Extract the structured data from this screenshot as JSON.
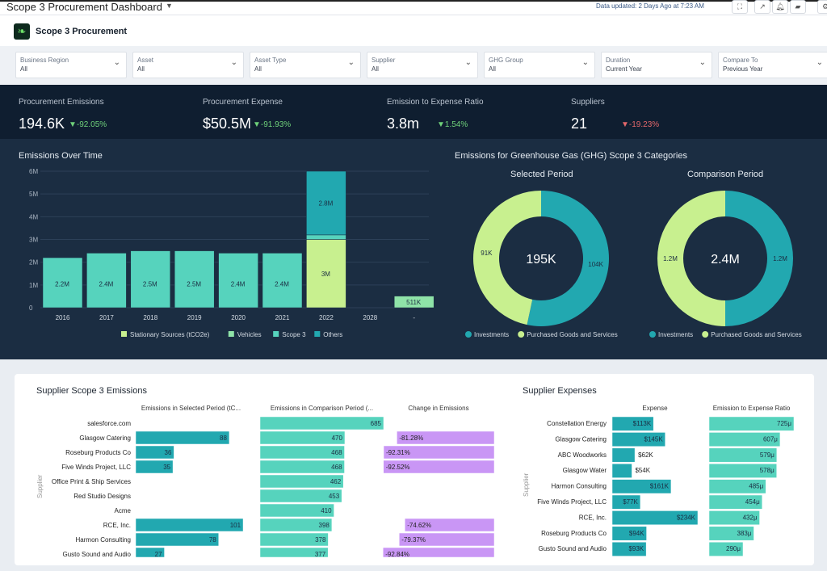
{
  "topbar": {
    "title": "Scope 3 Procurement Dashboard",
    "updated": "Data updated: 2 Days Ago at 7:23 AM",
    "icons": [
      "fullscreen-icon",
      "share-icon",
      "bell-icon",
      "folder-icon",
      "settings-icon"
    ]
  },
  "header": {
    "brand": "Scope 3 Procurement",
    "logo_icon": "leaf-icon"
  },
  "filters": [
    {
      "label": "Business Region",
      "value": "All"
    },
    {
      "label": "Asset",
      "value": "All"
    },
    {
      "label": "Asset Type",
      "value": "All"
    },
    {
      "label": "Supplier",
      "value": "All"
    },
    {
      "label": "GHG Group",
      "value": "All"
    },
    {
      "label": "Duration",
      "value": "Current Year"
    },
    {
      "label": "Compare To",
      "value": "Previous Year"
    }
  ],
  "kpis": [
    {
      "label": "Procurement Emissions",
      "value": "194.6K",
      "delta": "▼-92.05%",
      "color": "#6fd17a"
    },
    {
      "label": "Procurement Expense",
      "value": "$50.5M",
      "delta": "▼-91.93%",
      "color": "#6fd17a"
    },
    {
      "label": "Emission to Expense Ratio",
      "value": "3.8m",
      "delta": "▼1.54%",
      "color": "#6fd17a"
    },
    {
      "label": "Suppliers",
      "value": "21",
      "delta": "▼-19.23%",
      "color": "#e2676a"
    }
  ],
  "colors": {
    "stationary": "#c8f08f",
    "vehicles": "#8fe3a8",
    "scope3": "#56d3bd",
    "others": "#22a8b0",
    "purple": "#c996f5",
    "navy": "#1b2d42"
  },
  "chart_data": [
    {
      "type": "bar",
      "title": "Emissions Over Time",
      "stacked": true,
      "categories": [
        "2016",
        "2017",
        "2018",
        "2019",
        "2020",
        "2021",
        "2022",
        "2028",
        "-"
      ],
      "yticks": [
        "0",
        "1M",
        "2M",
        "3M",
        "4M",
        "5M",
        "6M"
      ],
      "ylim": [
        0,
        6000000
      ],
      "grid": true,
      "legend": "bottom",
      "series": [
        {
          "name": "Stationary Sources (tCO2e)",
          "values": [
            0,
            0,
            0,
            0,
            0,
            0,
            3000000,
            0,
            0
          ]
        },
        {
          "name": "Vehicles",
          "values": [
            0,
            0,
            0,
            0,
            0,
            0,
            0,
            0,
            511000
          ]
        },
        {
          "name": "Scope 3",
          "values": [
            2200000,
            2400000,
            2500000,
            2500000,
            2400000,
            2400000,
            200000,
            0,
            0
          ]
        },
        {
          "name": "Others",
          "values": [
            0,
            0,
            0,
            0,
            0,
            0,
            2800000,
            0,
            0
          ]
        }
      ],
      "labels": [
        [
          "2.2M"
        ],
        [
          "2.4M"
        ],
        [
          "2.5M"
        ],
        [
          "2.5M"
        ],
        [
          "2.4M"
        ],
        [
          "2.4M"
        ],
        [
          "3M",
          "2.8M"
        ],
        [],
        [
          "511K"
        ]
      ]
    },
    {
      "type": "pie",
      "title": "Emissions for Greenhouse Gas (GHG) Scope 3 Categories",
      "subtitle": "Selected Period",
      "center": "195K",
      "slices": [
        {
          "name": "Investments",
          "value": 104000,
          "label": "104K"
        },
        {
          "name": "Purchased Goods and Services",
          "value": 91000,
          "label": "91K"
        }
      ]
    },
    {
      "type": "pie",
      "subtitle": "Comparison Period",
      "center": "2.4M",
      "slices": [
        {
          "name": "Investments",
          "value": 1200000,
          "label": "1.2M"
        },
        {
          "name": "Purchased Goods and Services",
          "value": 1200000,
          "label": "1.2M"
        }
      ]
    },
    {
      "type": "bar",
      "orientation": "horizontal",
      "title": "Supplier Scope 3 Emissions",
      "ylabel": "Supplier",
      "categories": [
        "salesforce.com",
        "Glasgow Catering",
        "Roseburg Products Co",
        "Five Winds Project, LLC",
        "Office Print & Ship Services",
        "Red Studio Designs",
        "Acme",
        "RCE, Inc.",
        "Harmon Consulting",
        "Gusto Sound and Audio"
      ],
      "columns": [
        {
          "name": "Emissions in Selected Period (tC...",
          "values": [
            null,
            88,
            36,
            35,
            null,
            null,
            null,
            101,
            78,
            27
          ],
          "labels": [
            "",
            "88",
            "36",
            "35",
            "",
            "",
            "",
            "101",
            "78",
            "27"
          ]
        },
        {
          "name": "Emissions in Comparison Period (...",
          "values": [
            685,
            470,
            468,
            468,
            462,
            453,
            410,
            398,
            378,
            377
          ],
          "labels": [
            "685",
            "470",
            "468",
            "468",
            "462",
            "453",
            "410",
            "398",
            "378",
            "377"
          ]
        },
        {
          "name": "Change in Emissions",
          "values": [
            null,
            -81.28,
            -92.31,
            -92.52,
            null,
            null,
            null,
            -74.62,
            -79.37,
            -92.84
          ],
          "labels": [
            "",
            "-81.28%",
            "-92.31%",
            "-92.52%",
            "",
            "",
            "",
            "-74.62%",
            "-79.37%",
            "-92.84%"
          ]
        }
      ]
    },
    {
      "type": "bar",
      "orientation": "horizontal",
      "title": "Supplier Expenses",
      "ylabel": "Supplier",
      "categories": [
        "Constellation Energy",
        "Glasgow Catering",
        "ABC Woodworks",
        "Glasgow Water",
        "Harmon Consulting",
        "Five Winds Project, LLC",
        "RCE, Inc.",
        "Roseburg Products Co",
        "Gusto Sound and Audio"
      ],
      "columns": [
        {
          "name": "Expense",
          "values": [
            113000,
            145000,
            62000,
            54000,
            161000,
            77000,
            234000,
            94000,
            93000
          ],
          "labels": [
            "$113K",
            "$145K",
            "$62K",
            "$54K",
            "$161K",
            "$77K",
            "$234K",
            "$94K",
            "$93K"
          ]
        },
        {
          "name": "Emission to Expense Ratio",
          "values": [
            725,
            607,
            579,
            578,
            485,
            454,
            432,
            383,
            290
          ],
          "labels": [
            "725μ",
            "607μ",
            "579μ",
            "578μ",
            "485μ",
            "454μ",
            "432μ",
            "383μ",
            "290μ"
          ]
        }
      ]
    }
  ]
}
